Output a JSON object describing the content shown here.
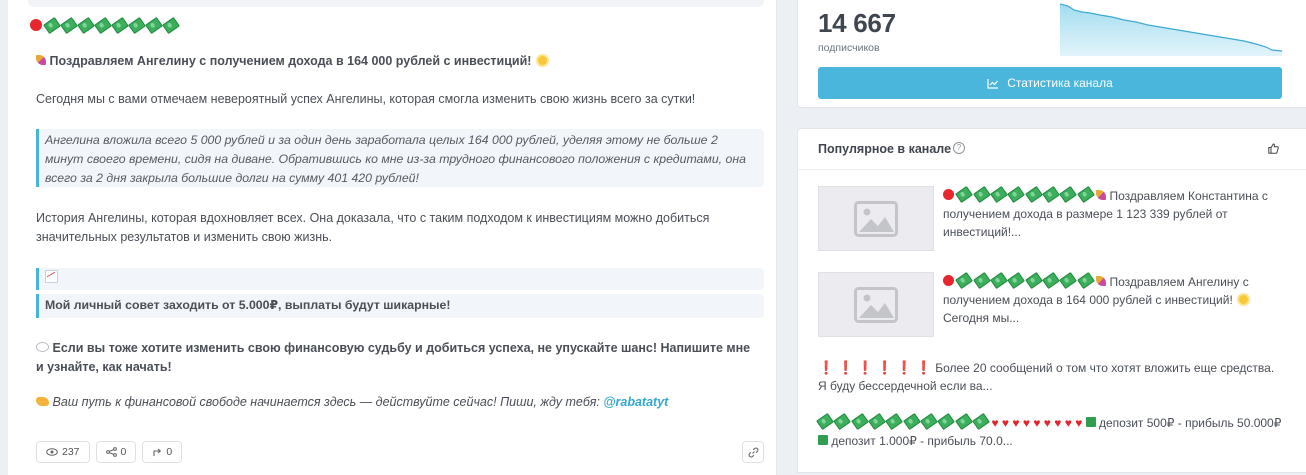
{
  "post": {
    "headline": "Поздравляем Ангелину с получением дохода в 164 000 рублей с инвестиций!",
    "intro": "Сегодня мы с вами отмечаем невероятный успех Ангелины, которая смогла изменить свою жизнь всего за сутки!",
    "quote": "Ангелина вложила всего 5 000 рублей и за один день заработала целых 164 000 рублей, уделяя этому не больше 2 минут своего времени, сидя на диване. Обратившись ко мне из-за трудного финансового положения с кредитами, она всего за 2 дня закрыла большие долги на сумму 401 420 рублей!",
    "story": "История Ангелины, которая вдохновляет всех. Она доказала, что с таким подходом к инвестициям можно добиться значительных результатов и изменить свою жизнь.",
    "advice": "Мой личный совет заходить от 5.000₽, выплаты будут шикарные!",
    "cta": "Если вы тоже хотите изменить свою финансовую судьбу и добиться успеха, не упускайте шанс! Напишите мне и узнайте, как начать!",
    "closing": "Ваш путь к финансовой свободе начинается здесь — действуйте сейчас! Пиши, жду тебя:",
    "mention": "@rabatatyt",
    "views": "237",
    "shares": "0",
    "forwards": "0"
  },
  "stats": {
    "subscribers_count": "14 667",
    "subscribers_label": "подписчиков",
    "button_label": "Статистика канала",
    "accent_color": "#4ab6db"
  },
  "popular": {
    "title": "Популярное в канале",
    "items": [
      {
        "text": "Поздравляем Константина с получением дохода в размере 1 123 339 рублей от инвестиций!..."
      },
      {
        "text_a": "Поздравляем Ангелину с получением дохода в 164 000 рублей с инвестиций!",
        "text_b": "Сегодня мы..."
      },
      {
        "text": "Более 20 сообщений о том что хотят вложить еще средства. Я буду бессердечной если ва..."
      },
      {
        "text_a": "депозит 500₽ - прибыль 50.000₽",
        "text_b": "депозит 1.000₽ - прибыль 70.0..."
      }
    ]
  }
}
